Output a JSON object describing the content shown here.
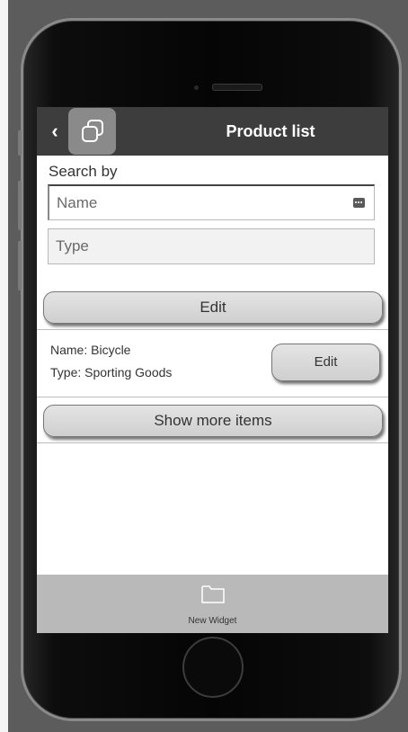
{
  "header": {
    "back_icon": "chevron-left-icon",
    "app_icon": "overlapping-squares-icon",
    "title": "Product list"
  },
  "search": {
    "label": "Search by",
    "name_placeholder": "Name",
    "type_placeholder": "Type",
    "keyboard_icon": "keyboard-icon"
  },
  "buttons": {
    "edit_label": "Edit",
    "show_more_label": "Show more items"
  },
  "items": [
    {
      "name": "Name: Bicycle",
      "type": "Type: Sporting Goods",
      "edit_label": "Edit"
    }
  ],
  "bottom_bar": {
    "widget_icon": "folder-icon",
    "widget_label": "New Widget",
    "background": "#b9b9b9"
  },
  "colors": {
    "header_bg": "#3d3d3d",
    "header_text": "#ffffff",
    "button_bg": "#d9d9d9"
  }
}
